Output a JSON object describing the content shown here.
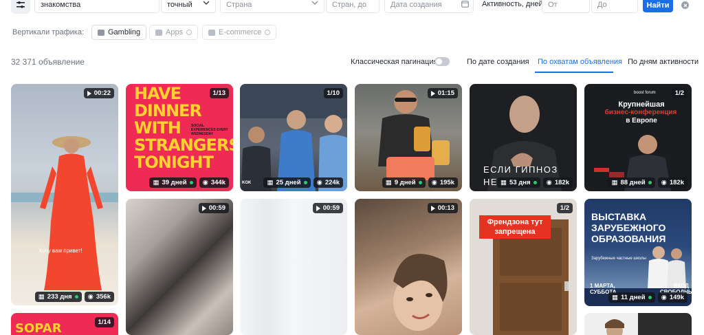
{
  "filters": {
    "keyword": "знакомства",
    "match_type": "точный",
    "country_placeholder": "Страна",
    "countries_to_placeholder": "Стран, до",
    "created_placeholder": "Дата создания",
    "activity_label": "Активность, дней",
    "from_placeholder": "От",
    "to_placeholder": "До",
    "find_label": "Найти"
  },
  "verticals": {
    "label": "Вертикали трафика:",
    "items": [
      {
        "label": "Gambling"
      },
      {
        "label": "Apps"
      },
      {
        "label": "E-commerce"
      }
    ]
  },
  "results": {
    "count": "32 371 объявление",
    "pagination_label": "Классическая пагинация",
    "sort_options": [
      "По дате создания",
      "По охватам объявления",
      "По дням активности"
    ],
    "active_sort": "По охватам объявления"
  },
  "cards": [
    {
      "badge": "00:22",
      "days": "233 дня",
      "reach": "356k",
      "caption": "Хочу вам привет!"
    },
    {
      "badge": "1/13",
      "days": "39 дней",
      "reach": "344k",
      "headline": "HAVE DINNER WITH STRANGERS TONIGHT",
      "subline": "SOCIAL EXPERIENCES EVERY WEDNESDAY"
    },
    {
      "badge": "1/10",
      "days": "25 дней",
      "reach": "224k",
      "corner": "KOK"
    },
    {
      "badge": "01:15",
      "days": "9 дней",
      "reach": "195k"
    },
    {
      "badge": "",
      "days": "53 дня",
      "reach": "182k",
      "caption": "ЕСЛИ ГИПНОЗ НЕ"
    },
    {
      "badge": "1/2",
      "days": "88 дней",
      "reach": "182k",
      "headline_a": "Крупнейшая",
      "headline_b": "бизнес-конференция",
      "headline_c": "в Европе",
      "brand": "boost forum"
    },
    {
      "badge": "00:59"
    },
    {
      "badge": "00:59"
    },
    {
      "badge": "00:13"
    },
    {
      "badge": "1/2",
      "caption": "Френдзона тут запрещена"
    },
    {
      "badge": "",
      "days": "11 дней",
      "reach": "149k",
      "headline": "ВЫСТАВКА ЗАРУБЕЖНОГО ОБРАЗОВАНИЯ",
      "subline": "Зарубежные частные школы",
      "date": "1 МАРТА, СУББОТА",
      "entry": "ВХОД СВОБОДНЫЙ"
    },
    {
      "badge": "1/14",
      "headline": "SOPAR"
    }
  ],
  "colors": {
    "accent": "#1a6fe8",
    "active_dot": "#2ecc71",
    "poster_pink": "#ee2a55",
    "poster_yellow": "#ffd230",
    "badge_bg": "#14161c"
  }
}
